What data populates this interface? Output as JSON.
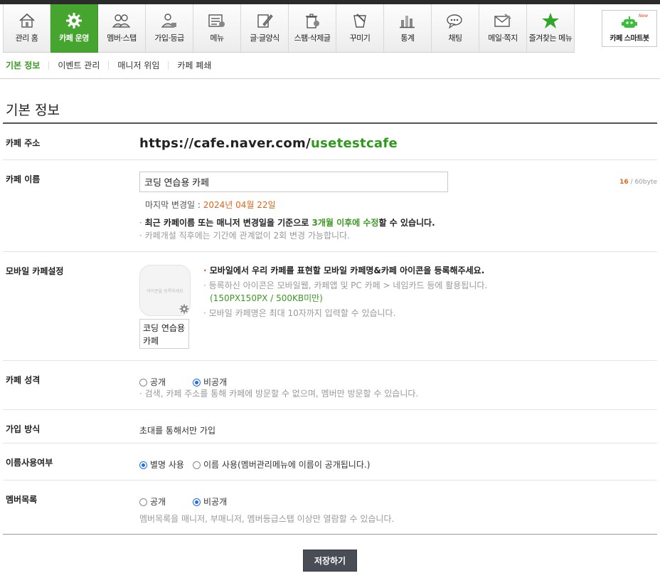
{
  "topnav": {
    "items": [
      {
        "label": "관리 홈",
        "icon": "home-icon"
      },
      {
        "label": "카페 운영",
        "icon": "gear-icon"
      },
      {
        "label": "멤버·스탭",
        "icon": "members-icon"
      },
      {
        "label": "가입·등급",
        "icon": "join-icon"
      },
      {
        "label": "메뉴",
        "icon": "menu-icon"
      },
      {
        "label": "글·글양식",
        "icon": "write-icon"
      },
      {
        "label": "스팸·삭제글",
        "icon": "trash-icon"
      },
      {
        "label": "꾸미기",
        "icon": "paint-icon"
      },
      {
        "label": "통계",
        "icon": "stats-icon"
      },
      {
        "label": "채팅",
        "icon": "chat-icon"
      },
      {
        "label": "메일·쪽지",
        "icon": "mail-icon"
      },
      {
        "label": "즐겨찾는 메뉴",
        "icon": "star-icon"
      }
    ],
    "active_index": 1,
    "smartbot": {
      "label": "카페 스마트봇",
      "badge": "New",
      "icon": "robot-icon"
    }
  },
  "subnav": {
    "tabs": [
      "기본 정보",
      "이벤트 관리",
      "매니저 위임",
      "카페 폐쇄"
    ]
  },
  "page_title": "기본 정보",
  "cafe_address": {
    "label": "카페 주소",
    "url_prefix": "https://cafe.naver.com/",
    "url_id": "usetestcafe"
  },
  "cafe_name": {
    "label": "카페 이름",
    "value": "코딩 연습용 카페",
    "byte_used": "16",
    "byte_max": " / 60byte",
    "last_changed_label": "마지막 변경일 : ",
    "last_changed_date": "2024년 04월 22일",
    "note1_pre": "최근 카페이름 또는 매니저 변경일을 기준으로 ",
    "note1_green": "3개월 이후에 수정",
    "note1_post": "할 수 있습니다.",
    "note2": "카페개설 직후에는 기간에 관계없이 2회 변경 가능합니다."
  },
  "mobile": {
    "label": "모바일 카페설정",
    "icon_placeholder": "아이콘을 등록하세요",
    "mobile_name": "코딩 연습용 카페",
    "note1": "모바일에서 우리 카페를 표현할 모바일 카페명&카페 아이콘을 등록해주세요.",
    "note2": "등록하신 아이콘은 모바일웹, 카페앱 및 PC 카페 > 네임카드 등에 활용됩니다.",
    "note2_green": "(150PX150PX / 500KB미만)",
    "note3": "모바일 카페명은 최대 10자까지 입력할 수 있습니다."
  },
  "cafe_type": {
    "label": "카페 성격",
    "options": [
      "공개",
      "비공개"
    ],
    "selected": 1,
    "note": "검색, 카페 주소를 통해 카페에 방문할 수 없으며, 멤버만 방문할 수 있습니다."
  },
  "join_method": {
    "label": "가입 방식",
    "value": "초대를 통해서만 가입"
  },
  "name_usage": {
    "label": "이름사용여부",
    "options": [
      "별명 사용",
      "이름 사용(멤버관리메뉴에 이름이 공개됩니다.)"
    ],
    "selected": 0
  },
  "member_list": {
    "label": "멤버목록",
    "options": [
      "공개",
      "비공개"
    ],
    "selected": 1,
    "note": "멤버목록을 매니저, 부매니저, 멤버등급스탭 이상만 열람할 수 있습니다."
  },
  "save_label": "저장하기",
  "colors": {
    "accent_green": "#45a52f",
    "link_green": "#2e9a1c",
    "orange": "#e0661b",
    "radio_blue": "#1f6ee6"
  }
}
